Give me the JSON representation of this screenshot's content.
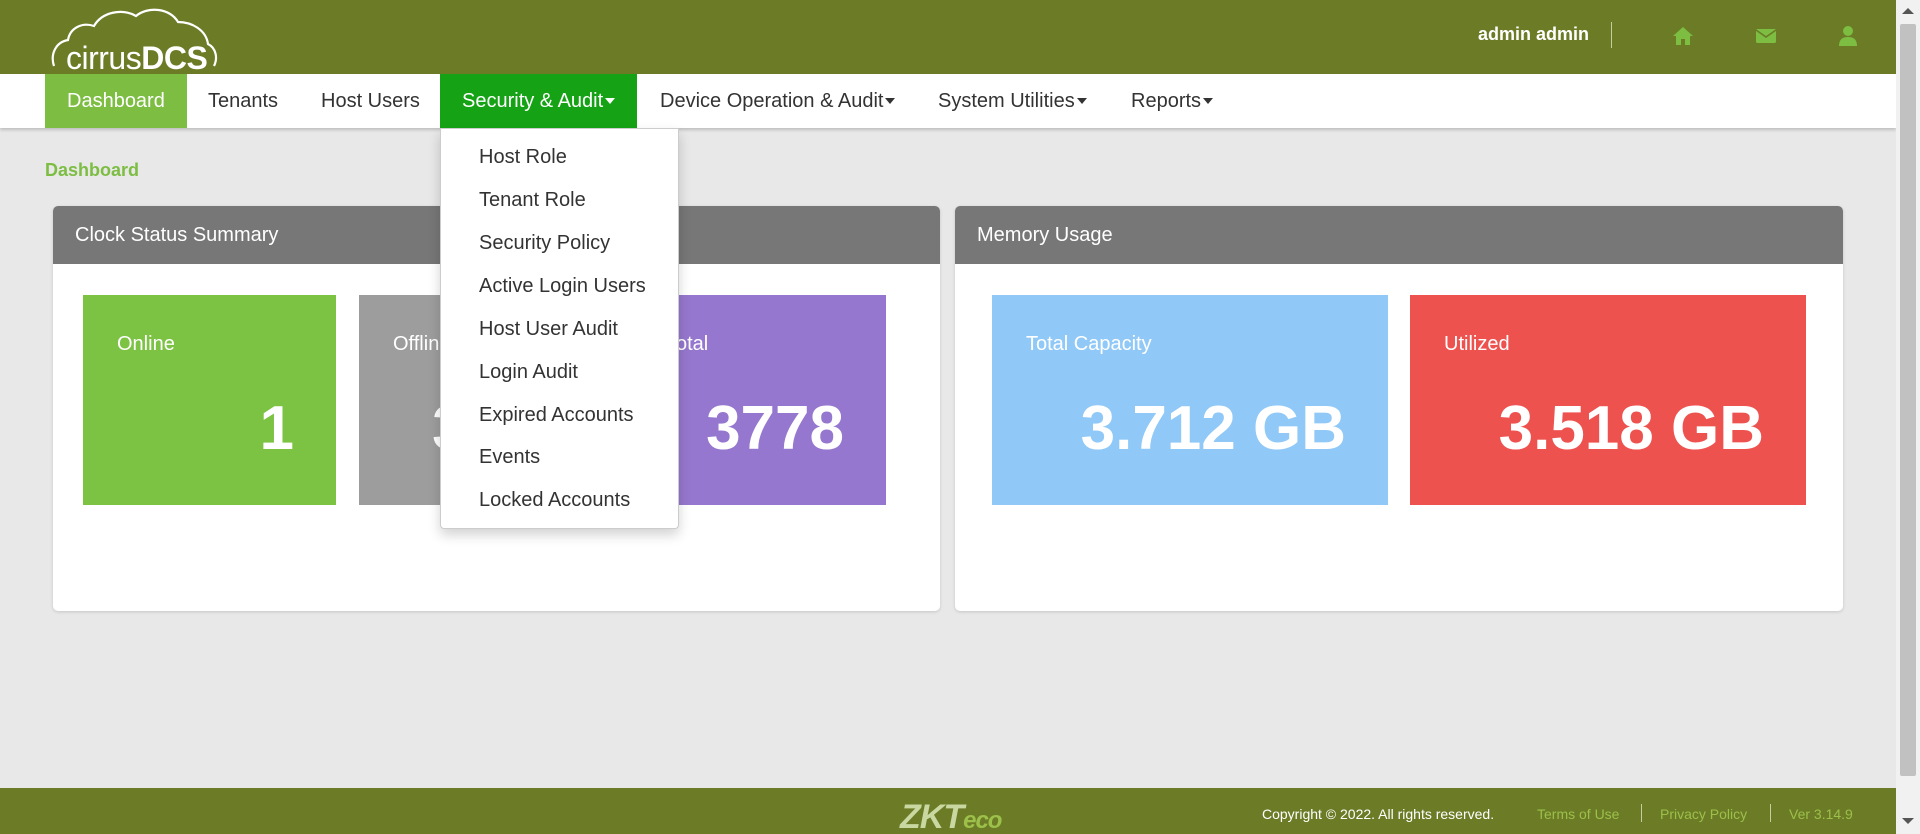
{
  "header": {
    "logo_text_thin": "cirrus",
    "logo_text_bold": "DCS",
    "user_name": "admin admin",
    "icons": [
      "home-icon",
      "envelope-icon",
      "user-icon"
    ]
  },
  "nav": {
    "items": [
      {
        "label": "Dashboard"
      },
      {
        "label": "Tenants"
      },
      {
        "label": "Host Users"
      },
      {
        "label": "Security & Audit"
      },
      {
        "label": "Device Operation & Audit"
      },
      {
        "label": "System Utilities"
      },
      {
        "label": "Reports"
      }
    ]
  },
  "breadcrumb": "Dashboard",
  "security_menu": {
    "items": [
      {
        "label": "Host Role"
      },
      {
        "label": "Tenant Role"
      },
      {
        "label": "Security Policy"
      },
      {
        "label": "Active Login Users"
      },
      {
        "label": "Host User Audit"
      },
      {
        "label": "Login Audit"
      },
      {
        "label": "Expired Accounts"
      },
      {
        "label": "Events"
      },
      {
        "label": "Locked Accounts"
      }
    ]
  },
  "clock_panel": {
    "title": "Clock Status Summary",
    "tiles": [
      {
        "label": "Online",
        "value": "1"
      },
      {
        "label": "Offline",
        "value": "3777"
      },
      {
        "label": "Total",
        "value": "3778"
      }
    ]
  },
  "memory_panel": {
    "title": "Memory Usage",
    "tiles": [
      {
        "label": "Total Capacity",
        "value": "3.712 GB"
      },
      {
        "label": "Utilized",
        "value": "3.518 GB"
      }
    ]
  },
  "footer": {
    "brand_zk": "ZKT",
    "brand_eco": "eco",
    "copyright": "Copyright © 2022. All rights reserved.",
    "terms": "Terms of Use",
    "privacy": "Privacy Policy",
    "version": "Ver 3.14.9"
  },
  "colors": {
    "header_bg": "#6b7b26",
    "accent_green": "#7cbd42",
    "active_menu": "#15a315",
    "online_tile": "#7cc243",
    "offline_tile": "#9d9d9d",
    "total_tile": "#9677cf",
    "capacity_tile": "#90c9f7",
    "utilized_tile": "#ee524f"
  }
}
